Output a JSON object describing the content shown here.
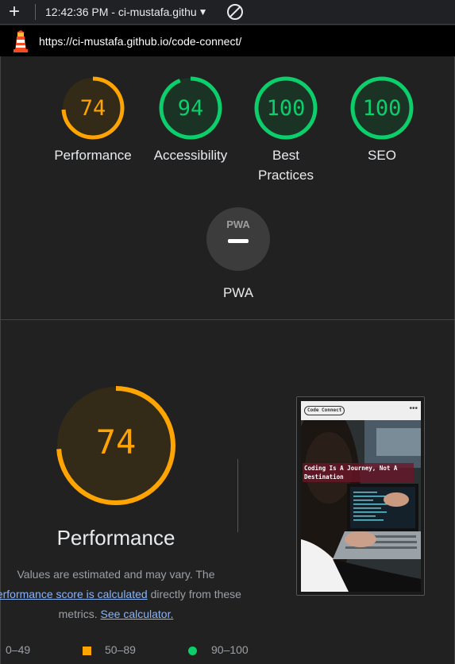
{
  "toolbar": {
    "add_label": "+",
    "report_title": "12:42:36 PM - ci-mustafa.githu",
    "caret": "▼"
  },
  "urlbar": {
    "url": "https://ci-mustafa.github.io/code-connect/"
  },
  "gauges": [
    {
      "score": "74",
      "label": "Performance",
      "rating": "average",
      "fraction": 0.74
    },
    {
      "score": "94",
      "label": "Accessibility",
      "rating": "pass",
      "fraction": 0.94
    },
    {
      "score": "100",
      "label": "Best Practices",
      "rating": "pass",
      "fraction": 1.0
    },
    {
      "score": "100",
      "label": "SEO",
      "rating": "pass",
      "fraction": 1.0
    }
  ],
  "pwa": {
    "badge": "PWA",
    "label": "PWA"
  },
  "performance": {
    "score": "74",
    "fraction": 0.74,
    "title": "Performance",
    "desc_prefix": "Values are estimated and may vary. The",
    "desc_link1": "performance score is calculated",
    "desc_mid": "directly from these",
    "desc_line3_prefix": "metrics.",
    "desc_link2": "See calculator."
  },
  "legend": {
    "fail": "0–49",
    "average": "50–89",
    "pass": "90–100"
  },
  "thumbnail": {
    "logo": "Code Connect",
    "dots": "•••",
    "caption": "Coding Is A Journey, Not A Destination"
  },
  "colors": {
    "average": "#ffa400",
    "pass": "#0cce6b",
    "fail": "#ff4e42",
    "background": "#212121"
  }
}
